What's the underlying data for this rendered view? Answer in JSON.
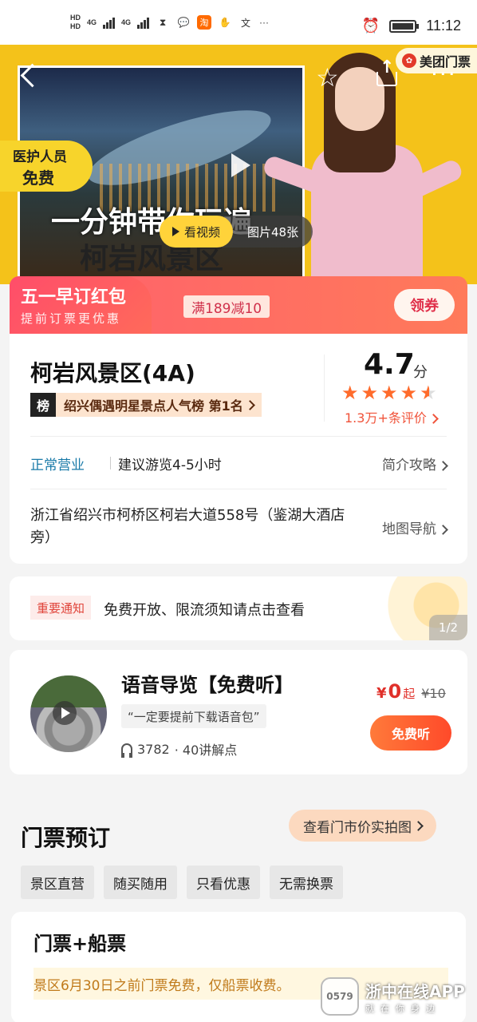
{
  "status_bar": {
    "hd1": "HD",
    "hd2": "HD",
    "net1": "4G",
    "net2": "4G",
    "time": "11:12"
  },
  "hero": {
    "caption_line1": "一分钟带你玩遍",
    "caption_line2": "柯岩风景区",
    "logo_text": "美团门票",
    "medic_line1": "医护人员",
    "medic_line2": "免费",
    "watch_label": "看视频",
    "photos_label": "图片48张"
  },
  "promo": {
    "title": "五一早订红包",
    "subtitle": "提前订票更优惠",
    "coupon": "满189减10",
    "claim_label": "领券"
  },
  "info": {
    "name": "柯岩风景区(4A)",
    "rank_key": "榜",
    "rank_text": "绍兴偶遇明星景点人气榜 第1名",
    "rating": "4.7",
    "rating_unit": "分",
    "rating_value": 4.7,
    "reviews": "1.3万+条评价",
    "status": "正常营业",
    "visit_time": "建议游览4-5小时",
    "guide_link": "简介攻略",
    "address": "浙江省绍兴市柯桥区柯岩大道558号（鉴湖大酒店旁）",
    "map_link": "地图导航"
  },
  "notice": {
    "tag": "重要通知",
    "text": "免费开放、限流须知请点击查看",
    "page": "1/2"
  },
  "audio": {
    "title": "语音导览【免费听】",
    "quote": "“一定要提前下载语音包”",
    "plays": "3782",
    "lectures": "· 40讲解点",
    "currency": "¥",
    "price": "0",
    "from": "起",
    "original_price": "¥10",
    "button": "免费听"
  },
  "tickets": {
    "title": "门票预订",
    "price_photo_button": "查看门市价实拍图",
    "filters": [
      "景区直营",
      "随买随用",
      "只看优惠",
      "无需换票"
    ],
    "combo_title": "门票+船票",
    "combo_notice": "景区6月30日之前门票免费，仅船票收费。"
  },
  "watermark": {
    "logo": "0579",
    "name": "浙中在线APP",
    "slogan": "就在你身边"
  },
  "colors": {
    "hero_bg": "#f4c21a",
    "promo_red": "#ff5f6d",
    "accent_orange": "#ff6b2b",
    "link_blue": "#1a7aa8"
  }
}
